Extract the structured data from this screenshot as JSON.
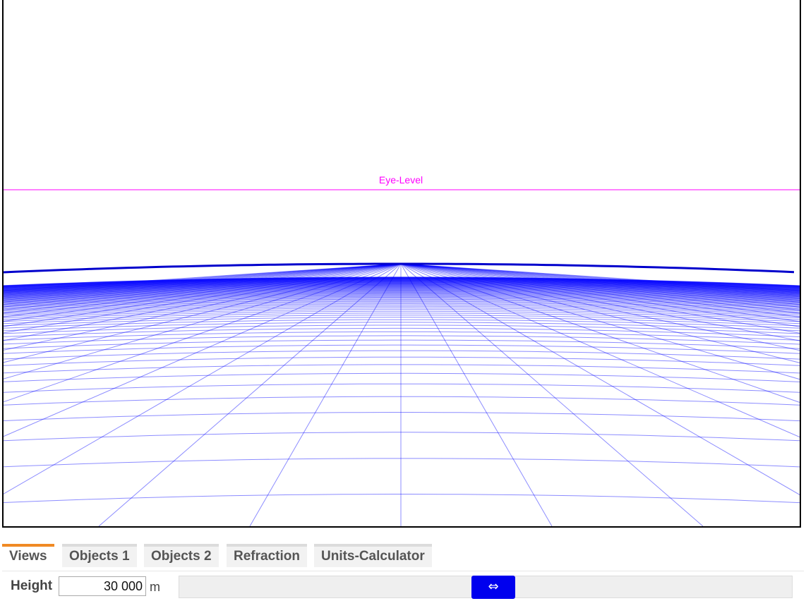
{
  "viewport": {
    "eye_level_label": "Eye-Level",
    "grid_color": "#0000ff",
    "eye_level_color": "#ff00ff"
  },
  "tabs": [
    {
      "label": "Views",
      "active": true
    },
    {
      "label": "Objects 1",
      "active": false
    },
    {
      "label": "Objects 2",
      "active": false
    },
    {
      "label": "Refraction",
      "active": false
    },
    {
      "label": "Units-Calculator",
      "active": false
    }
  ],
  "controls": {
    "height_label": "Height",
    "height_value": "30 000",
    "height_unit": "m",
    "slider_handle_icon": "left-right-arrow-icon",
    "slider_handle_glyph": "⇔",
    "slider_position": 0.5
  },
  "accent_color": "#f08a24"
}
